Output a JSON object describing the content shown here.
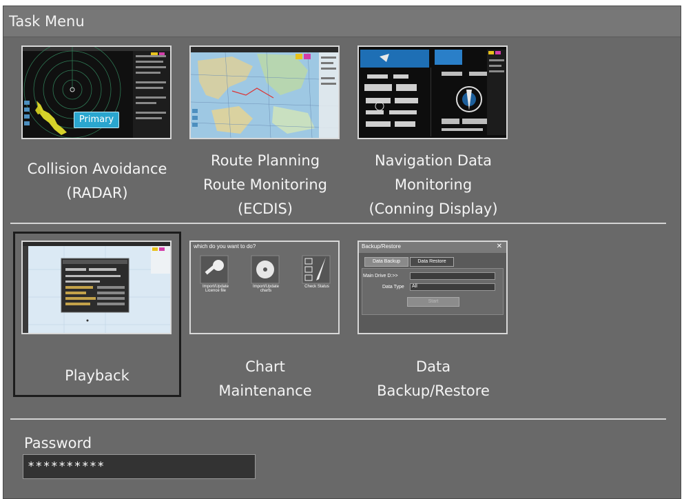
{
  "window": {
    "title": "Task Menu"
  },
  "tiles_top": [
    {
      "id": "radar",
      "label_lines": [
        "Collision Avoidance",
        "(RADAR)"
      ],
      "badge": "Primary"
    },
    {
      "id": "ecdis",
      "label_lines": [
        "Route Planning",
        "Route Monitoring",
        "(ECDIS)"
      ]
    },
    {
      "id": "conning",
      "label_lines": [
        "Navigation Data",
        "Monitoring",
        "(Conning Display)"
      ]
    }
  ],
  "tiles_bottom": [
    {
      "id": "playback",
      "label_lines": [
        "Playback"
      ]
    },
    {
      "id": "chart",
      "label_lines": [
        "Chart",
        "Maintenance"
      ]
    },
    {
      "id": "backup",
      "label_lines": [
        "Data",
        "Backup/Restore"
      ]
    }
  ],
  "chart_thumb": {
    "prompt": "which do you want to do?",
    "options": [
      "Import/Update Licence file",
      "Import/Update charts",
      "Check Status"
    ]
  },
  "backup_thumb": {
    "title": "Backup/Restore",
    "close": "✕",
    "tabs": [
      "Data Backup",
      "Data Restore"
    ],
    "drive_label": "Main Drive D:>>",
    "type_label": "Data Type",
    "type_value": "All",
    "start": "Start"
  },
  "password": {
    "label": "Password",
    "value": "**********"
  },
  "colors": {
    "background": "#696969",
    "badge": "#2aa6cf"
  }
}
